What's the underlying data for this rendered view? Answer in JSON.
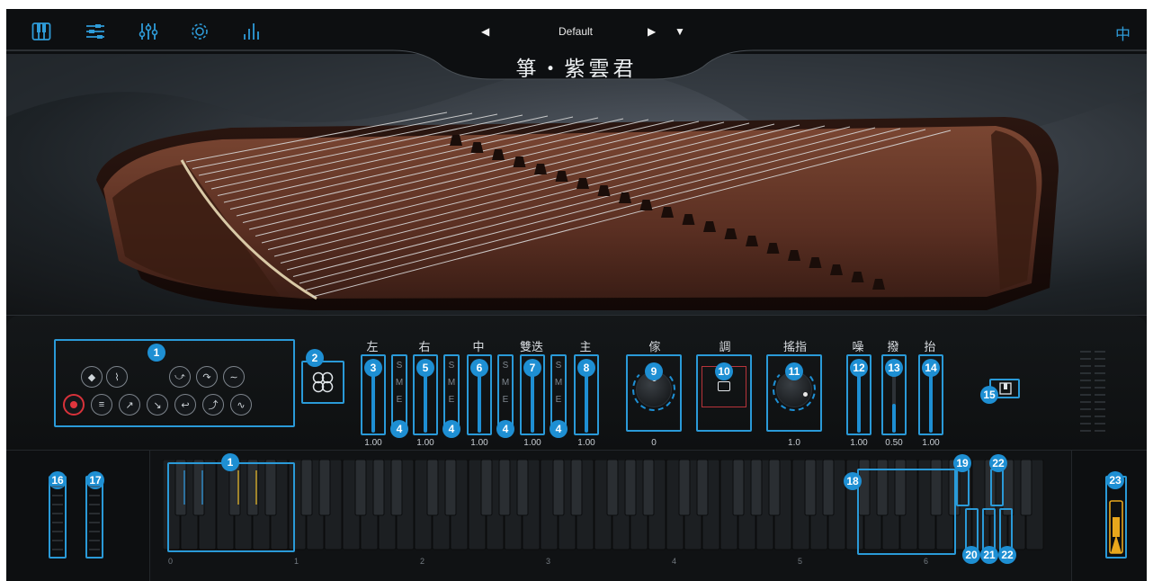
{
  "topbar": {
    "icons": [
      "keyboard-icon",
      "mixer-icon",
      "sliders-icon",
      "gear-icon",
      "equalizer-icon"
    ],
    "preset_name": "Default",
    "prev_symbol": "◀",
    "next_symbol": "▶",
    "menu_symbol": "▼",
    "language_button": "中"
  },
  "header": {
    "title": "箏・紫雲君"
  },
  "articulation_panel": {
    "badge": "1",
    "rows": [
      [
        "diamond-icon",
        "glissando-icon",
        "",
        "bend-up-down-icon",
        "bend-down-icon",
        "vibrato-icon"
      ],
      [
        "record-icon",
        "tremolo-icon",
        "slide-up-icon",
        "slide-down-icon",
        "bend-return-icon",
        "slide-up-fast-icon",
        "harmonic-icon"
      ]
    ]
  },
  "quad_button": {
    "badge": "2"
  },
  "sliders": [
    {
      "label": "左",
      "badge": "3",
      "value": "1.00",
      "sme_badge": "4",
      "fill": 1.0
    },
    {
      "label": "右",
      "badge": "5",
      "value": "1.00",
      "sme_badge": "4",
      "fill": 1.0
    },
    {
      "label": "中",
      "badge": "6",
      "value": "1.00",
      "sme_badge": "4",
      "fill": 1.0
    },
    {
      "label": "雙迭",
      "badge": "7",
      "value": "1.00",
      "sme_badge": "4",
      "fill": 1.0
    },
    {
      "label": "主",
      "badge": "8",
      "value": "1.00",
      "fill": 1.0
    }
  ],
  "sme_letters": [
    "S",
    "M",
    "E"
  ],
  "knob_controls": [
    {
      "label": "傢",
      "badge": "9",
      "value": "0"
    },
    {
      "label": "調",
      "badge": "10",
      "value": ""
    },
    {
      "label": "搖指",
      "badge": "11",
      "value": "1.0"
    }
  ],
  "right_sliders": [
    {
      "label": "噪",
      "badge": "12",
      "value": "1.00",
      "fill": 1.0
    },
    {
      "label": "撥",
      "badge": "13",
      "value": "0.50",
      "fill": 0.5
    },
    {
      "label": "抬",
      "badge": "14",
      "value": "1.00",
      "fill": 1.0
    }
  ],
  "keyboard_toggle": {
    "badge": "15"
  },
  "wheels": [
    {
      "badge": "16"
    },
    {
      "badge": "17"
    }
  ],
  "keyboard": {
    "octaves": [
      "0",
      "1",
      "2",
      "3",
      "4",
      "5",
      "6"
    ],
    "badges": {
      "keyswitch": "1",
      "range": "18",
      "k19": "19",
      "k20": "20",
      "k21": "21",
      "k22a": "22",
      "k22b": "22"
    }
  },
  "pedal": {
    "badge": "23"
  },
  "colors": {
    "accent": "#1e8fd3",
    "highlight": "#2a9ad8",
    "record": "#e0353d"
  }
}
